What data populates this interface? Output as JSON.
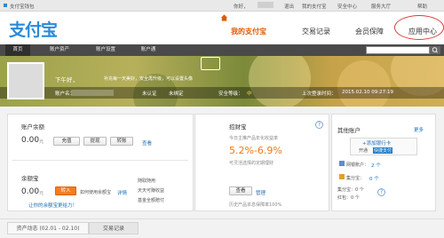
{
  "topbar": {
    "title": "支付宝钱包",
    "greeting": "你好，",
    "logout": "退出",
    "my_alipay": "我的支付宝",
    "security": "安全中心",
    "service": "服务大厅",
    "help": "帮助"
  },
  "header": {
    "logo": "支付宝",
    "nav": {
      "my_alipay": "我的支付宝",
      "records": "交易记录",
      "vip": "会员保障",
      "apps": "应用中心"
    }
  },
  "menubar": {
    "items": [
      "首页",
      "账户资产",
      "账户设置",
      "账户通"
    ]
  },
  "banner": {
    "greeting": "下午好，",
    "set_avatar": "补充每一天美好，安全再升级，可以设置头像",
    "account_label": "账户名：",
    "verified": "未认证",
    "unbound": "未绑定",
    "security_level": "安全等级：",
    "security_value": "中",
    "last_login_label": "上次登录时间：",
    "last_login_value": "2015.02.10 09:27:19"
  },
  "balance": {
    "title": "账户余额",
    "amount": "0.00",
    "unit": "元",
    "btn_recharge": "充值",
    "btn_withdraw": "提现",
    "btn_transfer": "转账",
    "view": "查看"
  },
  "yuebao": {
    "title": "余额宝",
    "amount": "0.00",
    "unit": "元",
    "btn_in": "转入",
    "desc": "如何使用余额宝",
    "detail": "详情",
    "promo": "让你的余额宝更给力！",
    "bullets": [
      "随取随用",
      "天天可赚收益",
      "基金全额赔付"
    ]
  },
  "zhaocaibao": {
    "title": "招财宝",
    "subtitle": "今日主推产品年化收益率",
    "rate": "5.2%-6.9%",
    "note": "可灵活选择的定期理财",
    "btn_view": "查看",
    "manage": "管理",
    "footer": "历史产品本息保障率100%"
  },
  "other_accounts": {
    "title": "其他账户",
    "more": "更多",
    "add_card_line1": "+添加银行卡",
    "add_card_line2": "开通",
    "express": "快捷支付",
    "netbank": "网银账户：",
    "netbank_count": "2 个",
    "coupons": "集分宝：",
    "coupons_val": "0 个",
    "red": "红包：",
    "red_val": "0 个",
    "points": "集分宝：0 个",
    "points2": "红包：0 个"
  },
  "bottom": {
    "tab1": "资产动态 (02.01 - 02.10)",
    "tab2": "交易记录"
  }
}
